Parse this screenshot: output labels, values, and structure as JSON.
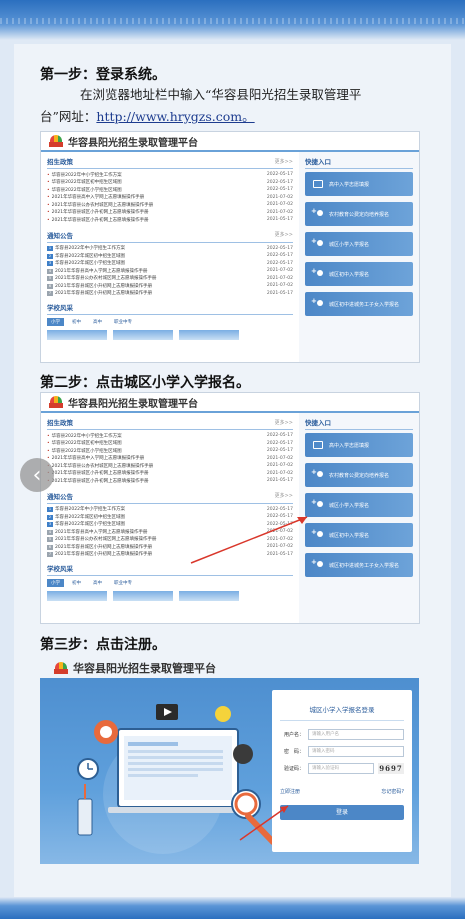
{
  "steps": {
    "s1_title": "第一步：登录系统。",
    "s1_text_a": "在浏览器地址栏中输入“华容县阳光招生录取管理平",
    "s1_text_b": "台”网址：",
    "s1_url": "http://www.hrygzs.com。",
    "s2_title": "第二步：点击城区小学入学报名。",
    "s3_title": "第三步：点击注册。"
  },
  "platform": {
    "name": "华容县阳光招生录取管理平台"
  },
  "portal": {
    "policy_title": "招生政策",
    "notice_title": "通知公告",
    "quick_title": "快捷入口",
    "gallery_title": "学校风采",
    "more": "更多>>",
    "policy_items": [
      {
        "text": "华容县2022年中小学招生工作方案",
        "date": "2022-05-17"
      },
      {
        "text": "华容县2022年城区初中招生区域图",
        "date": "2022-05-17"
      },
      {
        "text": "华容县2022年城区小学招生区域图",
        "date": "2022-05-17"
      },
      {
        "text": "2021年华容县高中入学网上志愿填报操作手册",
        "date": "2021-07-02"
      },
      {
        "text": "2021年华容县公办农村城区网上志愿填报操作手册",
        "date": "2021-07-02"
      },
      {
        "text": "2021年华容县城区小升初网上志愿填报操作手册",
        "date": "2021-07-02"
      },
      {
        "text": "2021年华容县城区小升初网上志愿填报操作手册",
        "date": "2021-05-17"
      }
    ],
    "notice_items": [
      {
        "text": "华容县2022年中小学招生工作方案",
        "date": "2022-05-17"
      },
      {
        "text": "华容县2022年城区初中招生区域图",
        "date": "2022-05-17"
      },
      {
        "text": "华容县2022年城区小学招生区域图",
        "date": "2022-05-17"
      },
      {
        "text": "2021年华容县高中入学网上志愿填报操作手册",
        "date": "2021-07-02"
      },
      {
        "text": "2021年华容县公办农村城区网上志愿填报操作手册",
        "date": "2021-07-02"
      },
      {
        "text": "2021年华容县城区小升初网上志愿填报操作手册",
        "date": "2021-07-02"
      },
      {
        "text": "2021年华容县城区小升初网上志愿填报操作手册",
        "date": "2021-05-17"
      }
    ],
    "quick_links": [
      "高中入学志愿填报",
      "农村教育公费定向培养报名",
      "城区小学入学报名",
      "城区初中入学报名",
      "城区初中进城务工子女入学报名"
    ],
    "gallery_tabs": [
      "小学",
      "初中",
      "高中",
      "职业中专"
    ]
  },
  "login": {
    "title": "城区小学入学报名登录",
    "user_label": "用户名：",
    "user_placeholder": "请输入用户名",
    "pwd_label": "密　码：",
    "pwd_placeholder": "请输入密码",
    "code_label": "验证码：",
    "code_placeholder": "请输入验证码",
    "captcha": "9697",
    "register": "立即注册",
    "forgot": "忘记密码?",
    "submit": "登录"
  },
  "colors": {
    "accent": "#4c87c7",
    "arrow": "#d9372b"
  }
}
